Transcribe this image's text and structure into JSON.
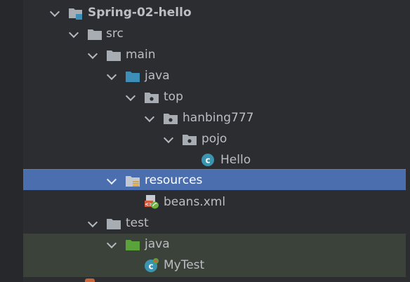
{
  "tree": {
    "nodes": [
      {
        "label": "Spring-02-hello",
        "icon": "module-folder-icon"
      },
      {
        "label": "src",
        "icon": "folder-icon"
      },
      {
        "label": "main",
        "icon": "folder-icon"
      },
      {
        "label": "java",
        "icon": "source-root-folder-icon"
      },
      {
        "label": "top",
        "icon": "package-icon"
      },
      {
        "label": "hanbing777",
        "icon": "package-icon"
      },
      {
        "label": "pojo",
        "icon": "package-icon"
      },
      {
        "label": "Hello",
        "icon": "java-class-icon"
      },
      {
        "label": "resources",
        "icon": "resources-root-folder-icon",
        "selected": true
      },
      {
        "label": "beans.xml",
        "icon": "spring-xml-file-icon"
      },
      {
        "label": "test",
        "icon": "folder-icon"
      },
      {
        "label": "java",
        "icon": "test-source-root-folder-icon"
      },
      {
        "label": "MyTest",
        "icon": "test-class-icon"
      }
    ]
  },
  "colors": {
    "background": "#2b2d30",
    "selection": "#4b6eaf",
    "test_highlight": "#3b4239",
    "text": "#bcbec4",
    "folder_gray": "#a7adb3",
    "source_blue": "#3d8eb9",
    "test_green": "#5aa33a",
    "class_teal": "#3a95b1"
  }
}
